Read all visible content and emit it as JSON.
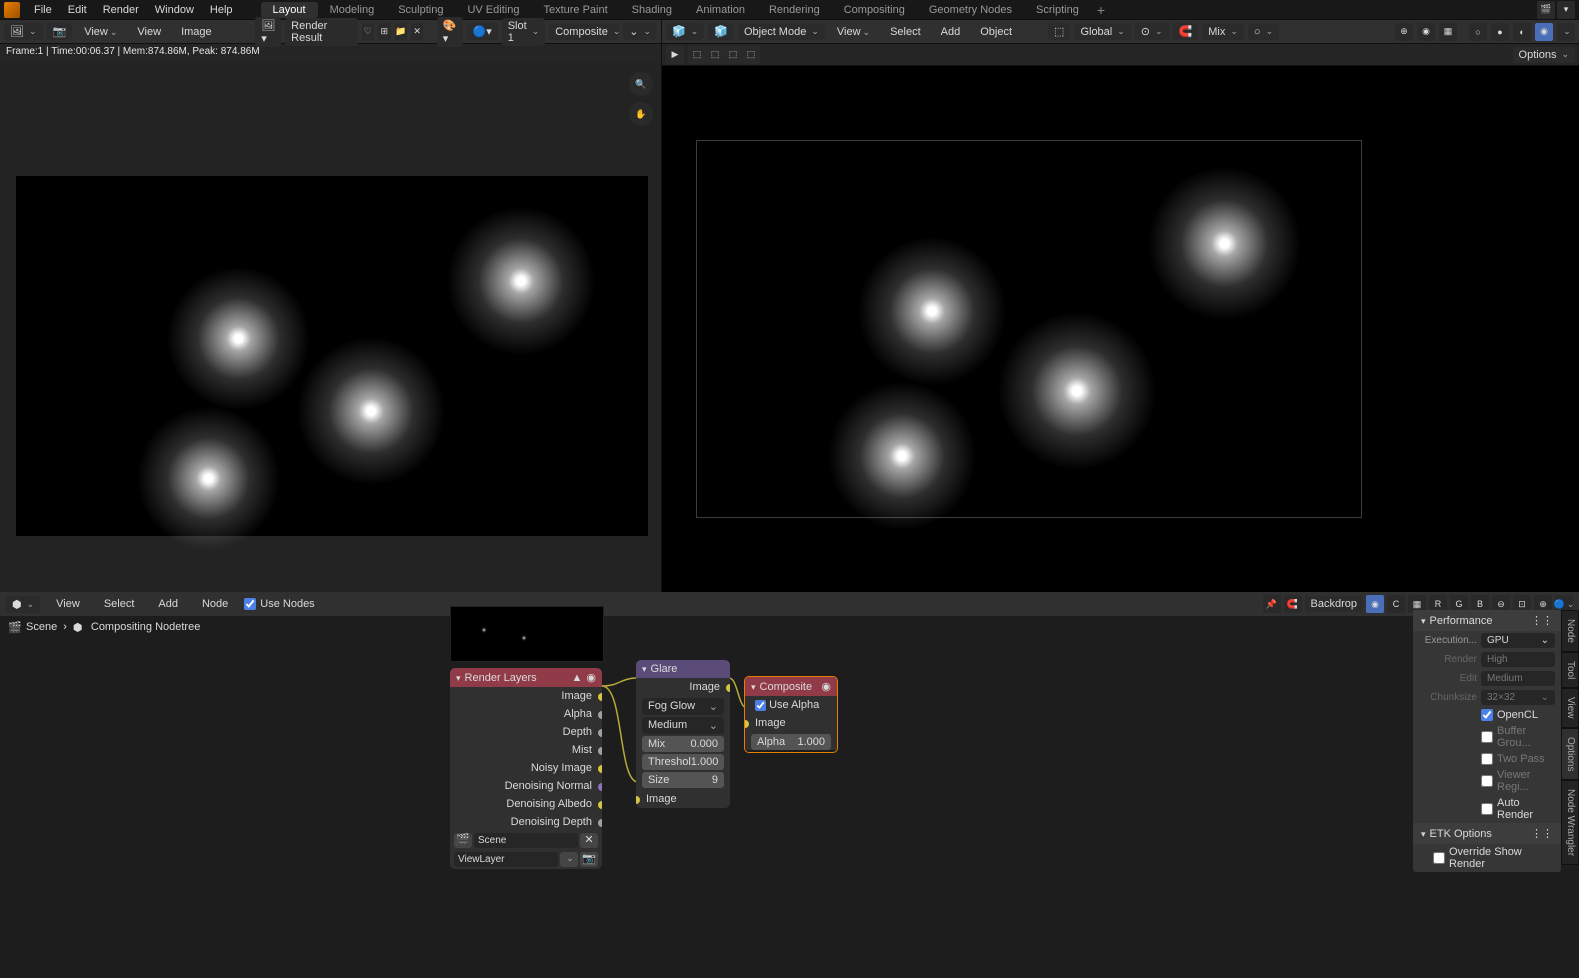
{
  "top_menu": {
    "file": "File",
    "edit": "Edit",
    "render": "Render",
    "window": "Window",
    "help": "Help"
  },
  "tabs": {
    "layout": "Layout",
    "modeling": "Modeling",
    "sculpting": "Sculpting",
    "uv": "UV Editing",
    "tex": "Texture Paint",
    "shading": "Shading",
    "anim": "Animation",
    "rendering": "Rendering",
    "comp": "Compositing",
    "geo": "Geometry Nodes",
    "script": "Scripting"
  },
  "image_editor": {
    "view": "View",
    "view2": "View",
    "image": "Image",
    "data": "Render Result",
    "slot": "Slot 1",
    "layer": "Composite",
    "status": "Frame:1 | Time:00:06.37 | Mem:874.86M, Peak: 874.86M"
  },
  "viewport": {
    "mode": "Object Mode",
    "view": "View",
    "select": "Select",
    "add": "Add",
    "object": "Object",
    "orient": "Global",
    "snap": "Mix",
    "options": "Options"
  },
  "compositor": {
    "view": "View",
    "select": "Select",
    "add": "Add",
    "node": "Node",
    "use_nodes": "Use Nodes",
    "backdrop": "Backdrop",
    "scene": "Scene",
    "tree": "Compositing Nodetree"
  },
  "nodes": {
    "render_layers": {
      "title": "Render Layers",
      "outs": [
        "Image",
        "Alpha",
        "Depth",
        "Mist",
        "Noisy Image",
        "Denoising Normal",
        "Denoising Albedo",
        "Denoising Depth"
      ],
      "scene": "Scene",
      "viewlayer": "ViewLayer"
    },
    "glare": {
      "title": "Glare",
      "out": "Image",
      "type": "Fog Glow",
      "quality": "Medium",
      "mix_l": "Mix",
      "mix_v": "0.000",
      "thr_l": "Threshol",
      "thr_v": "1.000",
      "size_l": "Size",
      "size_v": "9",
      "in": "Image"
    },
    "composite": {
      "title": "Composite",
      "use_alpha": "Use Alpha",
      "img": "Image",
      "alpha_l": "Alpha",
      "alpha_v": "1.000"
    }
  },
  "panel": {
    "performance": "Performance",
    "exec_l": "Execution...",
    "exec_v": "GPU",
    "render_l": "Render",
    "render_v": "High",
    "edit_l": "Edit",
    "edit_v": "Medium",
    "chunk_l": "Chunksize",
    "chunk_v": "32×32",
    "opencl": "OpenCL",
    "buffer": "Buffer Grou...",
    "twopass": "Two Pass",
    "viewer": "Viewer Regi...",
    "auto": "Auto Render",
    "etk": "ETK Options",
    "override": "Override Show Render"
  },
  "right_tabs": {
    "node": "Node",
    "tool": "Tool",
    "view": "View",
    "options": "Options",
    "wrangler": "Node Wrangler"
  },
  "channels": {
    "c": "C",
    "r": "R",
    "g": "G",
    "b": "B"
  }
}
